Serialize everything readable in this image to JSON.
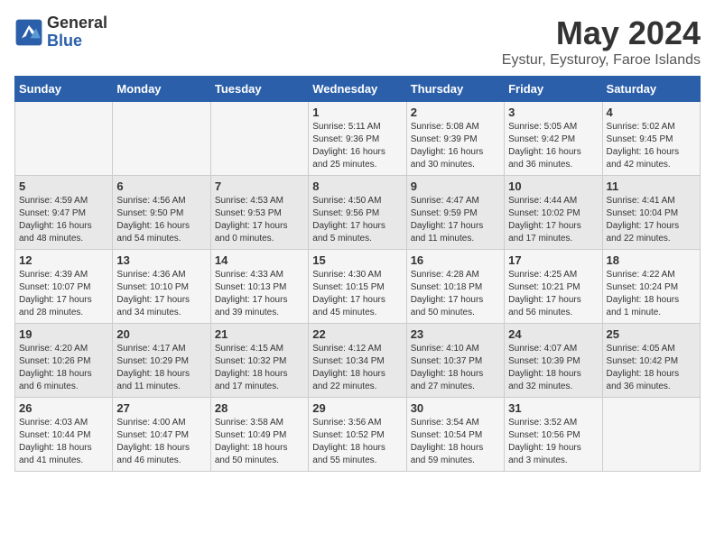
{
  "logo": {
    "general": "General",
    "blue": "Blue"
  },
  "header": {
    "month_year": "May 2024",
    "location": "Eystur, Eysturoy, Faroe Islands"
  },
  "weekdays": [
    "Sunday",
    "Monday",
    "Tuesday",
    "Wednesday",
    "Thursday",
    "Friday",
    "Saturday"
  ],
  "weeks": [
    [
      {
        "day": "",
        "info": ""
      },
      {
        "day": "",
        "info": ""
      },
      {
        "day": "",
        "info": ""
      },
      {
        "day": "1",
        "info": "Sunrise: 5:11 AM\nSunset: 9:36 PM\nDaylight: 16 hours\nand 25 minutes."
      },
      {
        "day": "2",
        "info": "Sunrise: 5:08 AM\nSunset: 9:39 PM\nDaylight: 16 hours\nand 30 minutes."
      },
      {
        "day": "3",
        "info": "Sunrise: 5:05 AM\nSunset: 9:42 PM\nDaylight: 16 hours\nand 36 minutes."
      },
      {
        "day": "4",
        "info": "Sunrise: 5:02 AM\nSunset: 9:45 PM\nDaylight: 16 hours\nand 42 minutes."
      }
    ],
    [
      {
        "day": "5",
        "info": "Sunrise: 4:59 AM\nSunset: 9:47 PM\nDaylight: 16 hours\nand 48 minutes."
      },
      {
        "day": "6",
        "info": "Sunrise: 4:56 AM\nSunset: 9:50 PM\nDaylight: 16 hours\nand 54 minutes."
      },
      {
        "day": "7",
        "info": "Sunrise: 4:53 AM\nSunset: 9:53 PM\nDaylight: 17 hours\nand 0 minutes."
      },
      {
        "day": "8",
        "info": "Sunrise: 4:50 AM\nSunset: 9:56 PM\nDaylight: 17 hours\nand 5 minutes."
      },
      {
        "day": "9",
        "info": "Sunrise: 4:47 AM\nSunset: 9:59 PM\nDaylight: 17 hours\nand 11 minutes."
      },
      {
        "day": "10",
        "info": "Sunrise: 4:44 AM\nSunset: 10:02 PM\nDaylight: 17 hours\nand 17 minutes."
      },
      {
        "day": "11",
        "info": "Sunrise: 4:41 AM\nSunset: 10:04 PM\nDaylight: 17 hours\nand 22 minutes."
      }
    ],
    [
      {
        "day": "12",
        "info": "Sunrise: 4:39 AM\nSunset: 10:07 PM\nDaylight: 17 hours\nand 28 minutes."
      },
      {
        "day": "13",
        "info": "Sunrise: 4:36 AM\nSunset: 10:10 PM\nDaylight: 17 hours\nand 34 minutes."
      },
      {
        "day": "14",
        "info": "Sunrise: 4:33 AM\nSunset: 10:13 PM\nDaylight: 17 hours\nand 39 minutes."
      },
      {
        "day": "15",
        "info": "Sunrise: 4:30 AM\nSunset: 10:15 PM\nDaylight: 17 hours\nand 45 minutes."
      },
      {
        "day": "16",
        "info": "Sunrise: 4:28 AM\nSunset: 10:18 PM\nDaylight: 17 hours\nand 50 minutes."
      },
      {
        "day": "17",
        "info": "Sunrise: 4:25 AM\nSunset: 10:21 PM\nDaylight: 17 hours\nand 56 minutes."
      },
      {
        "day": "18",
        "info": "Sunrise: 4:22 AM\nSunset: 10:24 PM\nDaylight: 18 hours\nand 1 minute."
      }
    ],
    [
      {
        "day": "19",
        "info": "Sunrise: 4:20 AM\nSunset: 10:26 PM\nDaylight: 18 hours\nand 6 minutes."
      },
      {
        "day": "20",
        "info": "Sunrise: 4:17 AM\nSunset: 10:29 PM\nDaylight: 18 hours\nand 11 minutes."
      },
      {
        "day": "21",
        "info": "Sunrise: 4:15 AM\nSunset: 10:32 PM\nDaylight: 18 hours\nand 17 minutes."
      },
      {
        "day": "22",
        "info": "Sunrise: 4:12 AM\nSunset: 10:34 PM\nDaylight: 18 hours\nand 22 minutes."
      },
      {
        "day": "23",
        "info": "Sunrise: 4:10 AM\nSunset: 10:37 PM\nDaylight: 18 hours\nand 27 minutes."
      },
      {
        "day": "24",
        "info": "Sunrise: 4:07 AM\nSunset: 10:39 PM\nDaylight: 18 hours\nand 32 minutes."
      },
      {
        "day": "25",
        "info": "Sunrise: 4:05 AM\nSunset: 10:42 PM\nDaylight: 18 hours\nand 36 minutes."
      }
    ],
    [
      {
        "day": "26",
        "info": "Sunrise: 4:03 AM\nSunset: 10:44 PM\nDaylight: 18 hours\nand 41 minutes."
      },
      {
        "day": "27",
        "info": "Sunrise: 4:00 AM\nSunset: 10:47 PM\nDaylight: 18 hours\nand 46 minutes."
      },
      {
        "day": "28",
        "info": "Sunrise: 3:58 AM\nSunset: 10:49 PM\nDaylight: 18 hours\nand 50 minutes."
      },
      {
        "day": "29",
        "info": "Sunrise: 3:56 AM\nSunset: 10:52 PM\nDaylight: 18 hours\nand 55 minutes."
      },
      {
        "day": "30",
        "info": "Sunrise: 3:54 AM\nSunset: 10:54 PM\nDaylight: 18 hours\nand 59 minutes."
      },
      {
        "day": "31",
        "info": "Sunrise: 3:52 AM\nSunset: 10:56 PM\nDaylight: 19 hours\nand 3 minutes."
      },
      {
        "day": "",
        "info": ""
      }
    ]
  ]
}
